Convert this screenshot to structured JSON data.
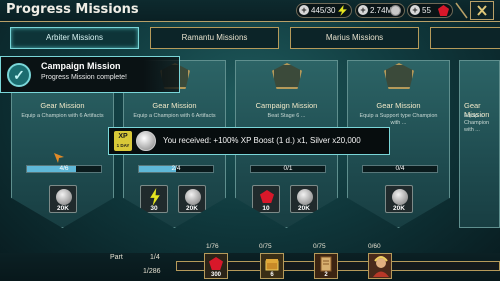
{
  "header": {
    "title": "Progress Missions",
    "energy": "445/30",
    "silver": "2.74M",
    "gems": "55"
  },
  "tabs": [
    {
      "label": "Arbiter Missions",
      "active": true
    },
    {
      "label": "Ramantu Missions",
      "active": false
    },
    {
      "label": "Marius Missions",
      "active": false
    }
  ],
  "cards": [
    {
      "title": "Gear Mission",
      "desc": "Equip a Champion with 6 Artifacts",
      "progress": "4/6",
      "progress_fraction": 0.667,
      "rewards": [
        {
          "icon": "silver-coin-icon",
          "amount": "20K"
        }
      ]
    },
    {
      "title": "Gear Mission",
      "desc": "Equip a Champion with 6 Artifacts",
      "progress": "2/4",
      "progress_fraction": 0.5,
      "rewards": [
        {
          "icon": "energy-bolt-icon",
          "amount": "30"
        },
        {
          "icon": "silver-coin-icon",
          "amount": "20K"
        }
      ]
    },
    {
      "title": "Campaign Mission",
      "desc": "Beat Stage 6 ...",
      "progress": "0/1",
      "progress_fraction": 0,
      "rewards": [
        {
          "icon": "gem-icon",
          "amount": "10"
        },
        {
          "icon": "silver-coin-icon",
          "amount": "20K"
        }
      ]
    },
    {
      "title": "Gear Mission",
      "desc": "Equip a Support type Champion with ...",
      "progress": "0/4",
      "progress_fraction": 0,
      "rewards": [
        {
          "icon": "silver-coin-icon",
          "amount": "20K"
        }
      ]
    },
    {
      "title": "Gear Mission",
      "desc": "Equip a Champion with ...",
      "progress": "",
      "progress_fraction": 0,
      "rewards": []
    }
  ],
  "toast_mission": {
    "title": "Campaign Mission",
    "subtitle": "Progress Mission complete!"
  },
  "toast_reward": {
    "xp_label": "XP",
    "xp_sub": "1 DAY",
    "message": "You received: +100% XP Boost (1 d.) x1, Silver x20,000"
  },
  "footer": {
    "part_label": "Part",
    "part_value": "1/4",
    "total_value": "1/286",
    "milestones": [
      {
        "label": "1/76",
        "amount": "300",
        "icon": "gem-icon"
      },
      {
        "label": "0/75",
        "amount": "6",
        "icon": "chest-icon"
      },
      {
        "label": "0/75",
        "amount": "2",
        "icon": "scroll-icon"
      },
      {
        "label": "0/60",
        "amount": "",
        "icon": "champion-portrait-icon"
      }
    ]
  },
  "colors": {
    "accent": "#7ad6d8",
    "gold_border": "#b59a5a",
    "progress_fill": "#5fb8d8"
  }
}
